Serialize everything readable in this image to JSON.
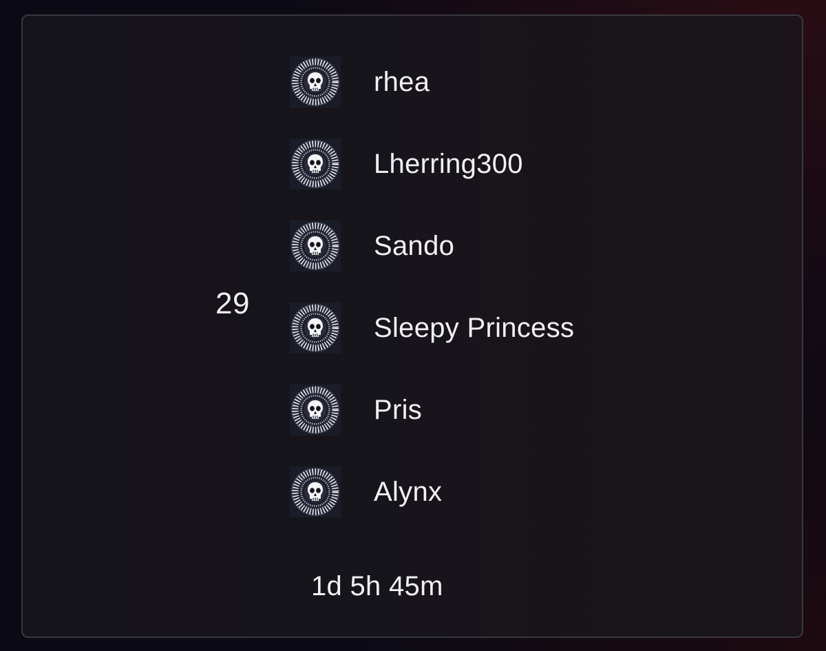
{
  "entry": {
    "rank": "29",
    "emblem_icon": "skull-sunburst-emblem-icon",
    "players": [
      {
        "name": "rhea"
      },
      {
        "name": "Lherring300"
      },
      {
        "name": "Sando"
      },
      {
        "name": "Sleepy Princess"
      },
      {
        "name": "Pris"
      },
      {
        "name": "Alynx"
      }
    ],
    "duration": "1d 5h 45m"
  },
  "colors": {
    "background": "#0b0a14",
    "card": "#16151b",
    "card_border": "#3a3740",
    "text": "#f2f0f4",
    "emblem_bg": "#1c1f2b"
  }
}
